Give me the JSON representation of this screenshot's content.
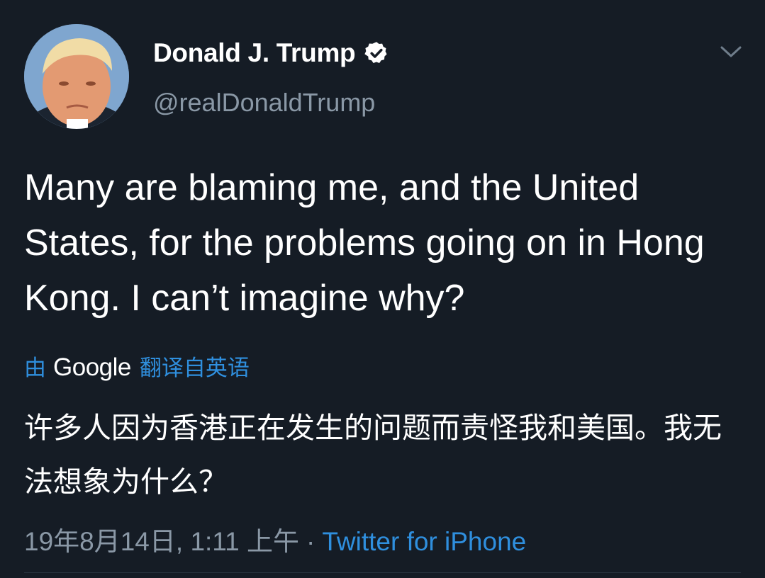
{
  "user": {
    "display_name": "Donald J. Trump",
    "handle": "@realDonaldTrump",
    "verified": true
  },
  "tweet": {
    "text": "Many are blaming me, and the United States, for the problems going on in Hong Kong. I can’t imagine why?"
  },
  "translation": {
    "by_label": "由",
    "service": "Google",
    "from_label": "翻译自英语",
    "text": "许多人因为香港正在发生的问题而责怪我和美国。我无法想象为什么？"
  },
  "meta": {
    "timestamp": "19年8月14日, 1:11 上午",
    "separator": "·",
    "source": "Twitter for iPhone"
  },
  "icons": {
    "verified": "verified-badge-icon",
    "menu": "chevron-down-icon"
  },
  "colors": {
    "background": "#151c25",
    "link": "#2f8fde",
    "secondary_text": "#8a98a6"
  }
}
